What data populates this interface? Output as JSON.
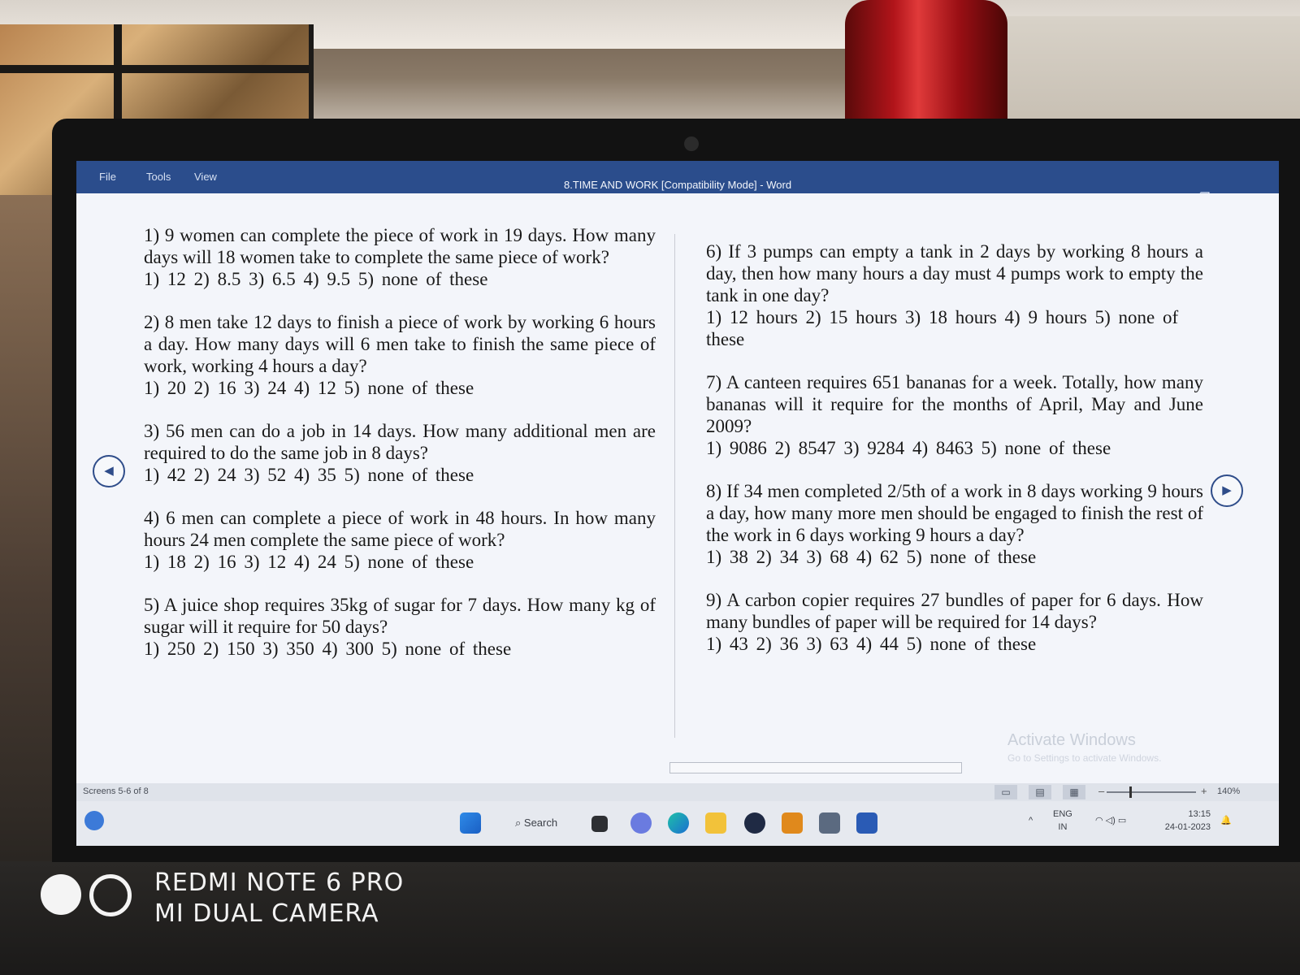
{
  "app": {
    "menu": [
      "File",
      "Tools",
      "View"
    ],
    "title": "8.TIME AND WORK [Compatibility Mode] - Word",
    "window_controls": [
      "⌗",
      "–",
      "❐",
      "✕"
    ]
  },
  "questions_left": [
    {
      "text": "1) 9 women can complete the piece of work in 19 days. How many days will 18 women take to complete the same piece of work?",
      "options": "1) 12   2) 8.5   3) 6.5   4) 9.5   5) none of these"
    },
    {
      "text": "2) 8 men take 12 days to finish a piece of work by working 6 hours a day. How many days will 6 men take to finish the same piece of work, working 4 hours a day?",
      "options": "1) 20   2) 16  3) 24   4) 12  5) none of these"
    },
    {
      "text": "3) 56 men can do a job in 14 days. How many additional men are required to do the same job in 8 days?",
      "options": "1) 42   2) 24   3) 52   4) 35   5) none of these"
    },
    {
      "text": "4) 6 men can complete a piece of work in 48 hours. In how many hours 24 men complete the same piece of work?",
      "options": "1) 18   2) 16   3) 12   4) 24   5) none of these"
    },
    {
      "text": "5) A juice shop requires 35kg of sugar for 7 days. How many kg of sugar will it require for 50 days?",
      "options": "1) 250   2) 150   3) 350   4) 300   5) none of these"
    }
  ],
  "questions_right": [
    {
      "text": "6) If 3 pumps can empty a tank in 2 days by working 8 hours a day, then how many hours a day must 4 pumps work to empty the tank in one day?",
      "options": "1) 12 hours   2) 15 hours    3) 18 hours   4) 9 hours   5) none of these"
    },
    {
      "text": "7) A canteen requires 651 bananas for a week. Totally, how many bananas will it require for the months of April, May and June 2009?",
      "options": "1) 9086   2) 8547   3) 9284   4) 8463   5) none of these"
    },
    {
      "text": "8) If 34 men completed 2/5th of a work in 8 days working 9 hours a day, how many more men should be engaged to finish the rest of the work in 6 days working 9 hours a day?",
      "options": "1) 38   2) 34   3) 68   4) 62   5) none of these"
    },
    {
      "text": "9) A carbon copier requires 27 bundles of paper for 6 days. How many bundles of paper will be required for 14 days?",
      "options": "1) 43   2) 36   3) 63   4) 44   5) none of these"
    }
  ],
  "overlay": {
    "activate_title": "Activate Windows",
    "activate_sub": "Go to Settings to activate Windows."
  },
  "status": {
    "screens": "Screens 5-6 of 8",
    "zoom": "140%"
  },
  "taskbar": {
    "search": "Search",
    "lang_top": "ENG",
    "lang_bottom": "IN",
    "time": "13:15",
    "date": "24-01-2023"
  },
  "camera_watermark": {
    "line1": "REDMI NOTE 6 PRO",
    "line2": "MI DUAL CAMERA"
  }
}
